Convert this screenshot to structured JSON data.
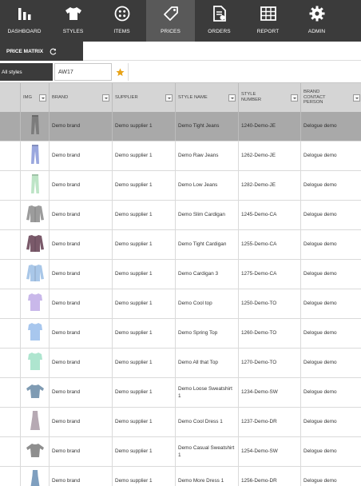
{
  "nav": [
    {
      "label": "DASHBOARD",
      "icon": "bar-chart-icon",
      "active": false
    },
    {
      "label": "STYLES",
      "icon": "tshirt-icon",
      "active": false
    },
    {
      "label": "ITEMS",
      "icon": "buttons-icon",
      "active": false
    },
    {
      "label": "PRICES",
      "icon": "price-tag-icon",
      "active": true
    },
    {
      "label": "ORDERS",
      "icon": "document-icon",
      "active": false
    },
    {
      "label": "REPORT",
      "icon": "table-icon",
      "active": false
    },
    {
      "label": "ADMIN",
      "icon": "gear-icon",
      "active": false
    }
  ],
  "subtab": {
    "label": "PRICE MATRIX",
    "refresh_icon": "refresh-icon"
  },
  "filter": {
    "styles_label": "All styles",
    "season_value": "AW17",
    "star_icon": "star-icon",
    "star_color": "#e8a317"
  },
  "columns": [
    "IMG",
    "BRAND",
    "SUPPLIER",
    "STYLE NAME",
    "STYLE NUMBER",
    "BRAND CONTACT PERSON"
  ],
  "rows": [
    {
      "img": "jeans",
      "color": "#7c7c7c",
      "brand": "Demo brand",
      "supplier": "Demo supplier 1",
      "name": "Demo Tight Jeans",
      "number": "1240-Demo-JE",
      "contact": "Delogue demo",
      "selected": true
    },
    {
      "img": "jeans",
      "color": "#9aa7de",
      "brand": "Demo brand",
      "supplier": "Demo supplier 1",
      "name": "Demo Raw Jeans",
      "number": "1262-Demo-JE",
      "contact": "Delogue demo",
      "selected": false
    },
    {
      "img": "jeans",
      "color": "#bde4c6",
      "brand": "Demo brand",
      "supplier": "Demo supplier 1",
      "name": "Demo Low Jeans",
      "number": "1282-Demo-JE",
      "contact": "Delogue demo",
      "selected": false
    },
    {
      "img": "cardigan",
      "color": "#9c9c9c",
      "brand": "Demo brand",
      "supplier": "Demo supplier 1",
      "name": "Demo Slim Cardigan",
      "number": "1245-Demo-CA",
      "contact": "Delogue demo",
      "selected": false
    },
    {
      "img": "cardigan",
      "color": "#7a5a6a",
      "brand": "Demo brand",
      "supplier": "Demo supplier 1",
      "name": "Demo Tight Cardigan",
      "number": "1255-Demo-CA",
      "contact": "Delogue demo",
      "selected": false
    },
    {
      "img": "cardigan",
      "color": "#a9c7e8",
      "brand": "Demo brand",
      "supplier": "Demo supplier 1",
      "name": "Demo Cardigan 3",
      "number": "1275-Demo-CA",
      "contact": "Delogue demo",
      "selected": false
    },
    {
      "img": "top",
      "color": "#c9b8ea",
      "brand": "Demo brand",
      "supplier": "Demo supplier 1",
      "name": "Demo Cool top",
      "number": "1250-Demo-TO",
      "contact": "Delogue demo",
      "selected": false
    },
    {
      "img": "top",
      "color": "#a8c7ee",
      "brand": "Demo brand",
      "supplier": "Demo supplier 1",
      "name": "Demo Spring Top",
      "number": "1260-Demo-TO",
      "contact": "Delogue demo",
      "selected": false
    },
    {
      "img": "top",
      "color": "#aee5cf",
      "brand": "Demo brand",
      "supplier": "Demo supplier 1",
      "name": "Demo All that Top",
      "number": "1270-Demo-TO",
      "contact": "Delogue demo",
      "selected": false
    },
    {
      "img": "sweat",
      "color": "#7f9bb3",
      "brand": "Demo brand",
      "supplier": "Demo supplier 1",
      "name": "Demo Loose Sweatshirt 1",
      "number": "1234-Demo-SW",
      "contact": "Delogue demo",
      "selected": false
    },
    {
      "img": "dress",
      "color": "#b6a9b3",
      "brand": "Demo brand",
      "supplier": "Demo supplier 1",
      "name": "Demo Cool Dress 1",
      "number": "1237-Demo-DR",
      "contact": "Delogue demo",
      "selected": false
    },
    {
      "img": "sweat",
      "color": "#8e8e8e",
      "brand": "Demo brand",
      "supplier": "Demo supplier 1",
      "name": "Demo Casual Sweatshirt 1",
      "number": "1254-Demo-SW",
      "contact": "Delogue demo",
      "selected": false
    },
    {
      "img": "dress",
      "color": "#7f9fbf",
      "brand": "Demo brand",
      "supplier": "Demo supplier 1",
      "name": "Demo More Dress 1",
      "number": "1256-Demo-DR",
      "contact": "Delogue demo",
      "selected": false
    }
  ]
}
